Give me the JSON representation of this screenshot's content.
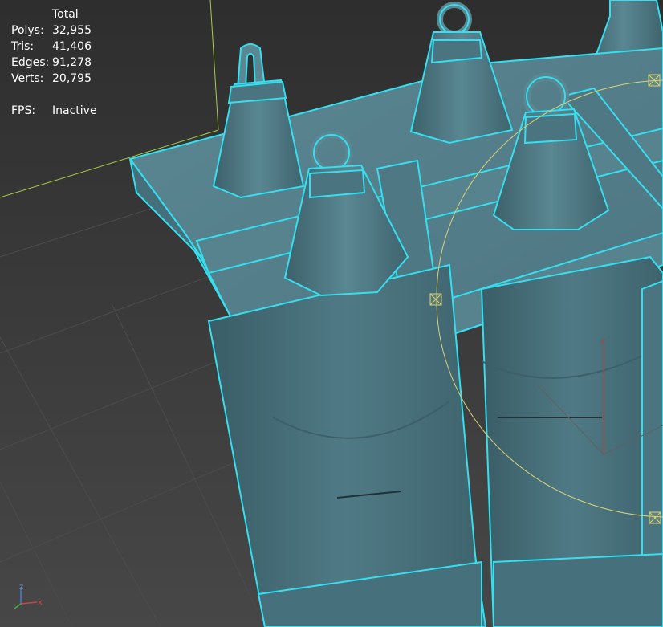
{
  "stats": {
    "header": "Total",
    "rows": [
      {
        "label": "Polys:",
        "value": "32,955"
      },
      {
        "label": "Tris:",
        "value": "41,406"
      },
      {
        "label": "Edges:",
        "value": "91,278"
      },
      {
        "label": "Verts:",
        "value": "20,795"
      }
    ],
    "fps_label": "FPS:",
    "fps_value": "Inactive"
  },
  "gizmo": {
    "z_label": "z",
    "x_label": "x",
    "local_z_label": "z"
  },
  "colors": {
    "background": "#3b3b3b",
    "model_fill": "#4f7a85",
    "selection_outline": "#35dff0",
    "grid_line": "#4a4a4a",
    "camera_line": "#b6d84e",
    "gizmo_circle": "#d6d27a"
  }
}
